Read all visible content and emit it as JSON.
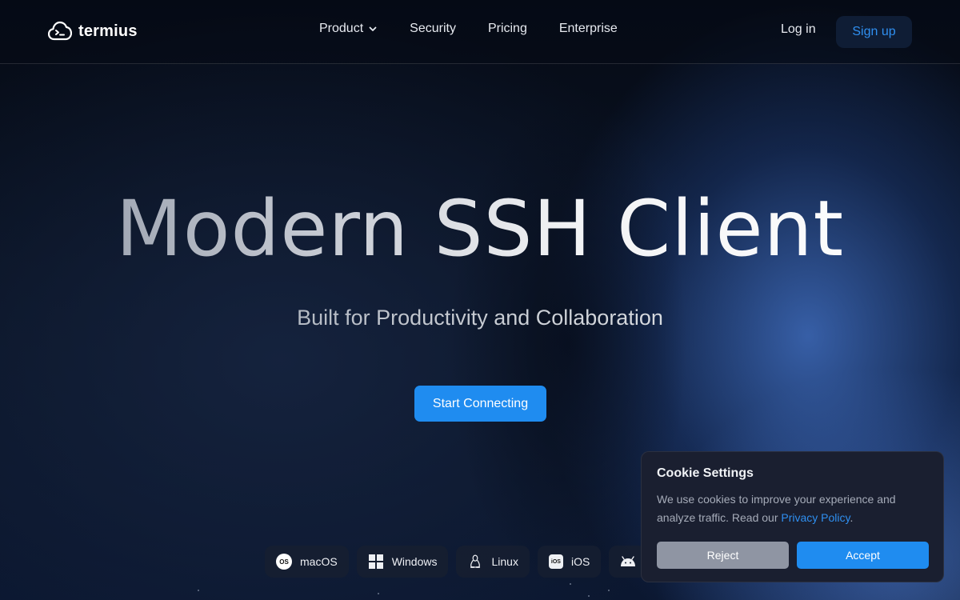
{
  "header": {
    "logo_text": "termius",
    "nav": [
      {
        "label": "Product"
      },
      {
        "label": "Security"
      },
      {
        "label": "Pricing"
      },
      {
        "label": "Enterprise"
      }
    ],
    "login_label": "Log in",
    "signup_label": "Sign up"
  },
  "hero": {
    "title": "Modern SSH Client",
    "subtitle": "Built for Productivity and Collaboration",
    "cta_label": "Start Connecting"
  },
  "platforms": [
    {
      "label": "macOS",
      "icon": "macos-icon"
    },
    {
      "label": "Windows",
      "icon": "windows-icon"
    },
    {
      "label": "Linux",
      "icon": "linux-icon"
    },
    {
      "label": "iOS",
      "icon": "ios-icon"
    },
    {
      "label": "",
      "icon": "android-icon"
    }
  ],
  "cookie": {
    "title": "Cookie Settings",
    "text": "We use cookies to improve your experience and analyze traffic. Read our ",
    "link_label": "Privacy Policy",
    "text_end": ".",
    "reject_label": "Reject",
    "accept_label": "Accept"
  },
  "colors": {
    "accent": "#1f8cf0",
    "background": "#070d1a",
    "signup_bg": "#0f1d35",
    "cookie_bg": "#1a1f30",
    "reject_bg": "#8f95a3"
  }
}
